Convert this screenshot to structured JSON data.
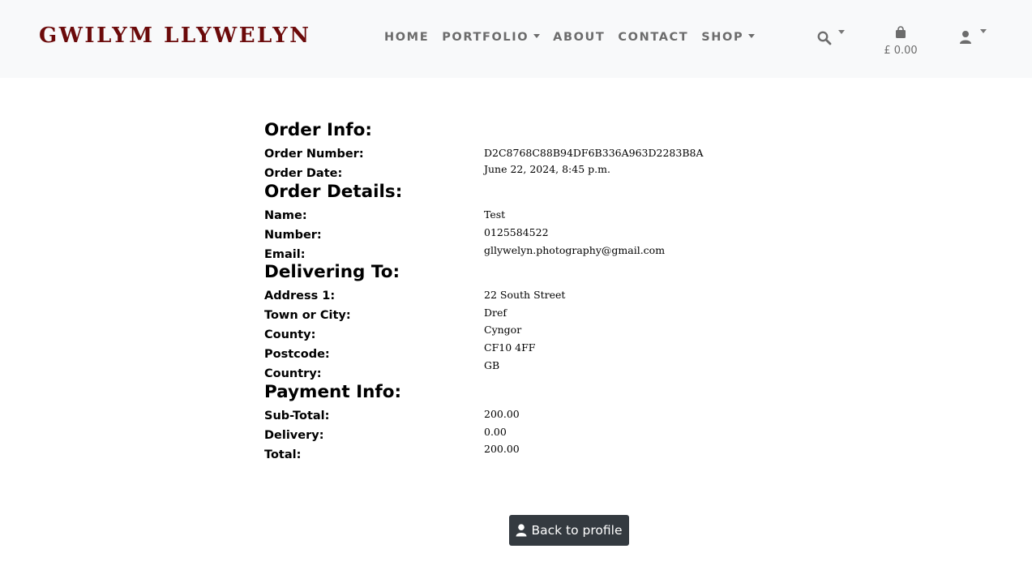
{
  "brand": {
    "name": "GWILYM LLYWELYN"
  },
  "nav": [
    {
      "label": "HOME",
      "dropdown": false
    },
    {
      "label": "PORTFOLIO",
      "dropdown": true
    },
    {
      "label": "ABOUT",
      "dropdown": false
    },
    {
      "label": "CONTACT",
      "dropdown": false
    },
    {
      "label": "SHOP",
      "dropdown": true
    }
  ],
  "cart": {
    "total": "£ 0.00"
  },
  "order_info": {
    "heading": "Order Info:",
    "number_label": "Order Number:",
    "number": "D2C8768C88B94DF6B336A963D2283B8A",
    "date_label": "Order Date:",
    "date": "June 22, 2024, 8:45 p.m."
  },
  "order_details": {
    "heading": "Order Details:",
    "name_label": "Name:",
    "name": "Test",
    "number_label": "Number:",
    "number": "0125584522",
    "email_label": "Email:",
    "email": "gllywelyn.photography@gmail.com"
  },
  "delivering": {
    "heading": "Delivering To:",
    "address1_label": "Address 1:",
    "address1": "22 South Street",
    "town_label": "Town or City:",
    "town": "Dref",
    "county_label": "County:",
    "county": "Cyngor",
    "postcode_label": "Postcode:",
    "postcode": "CF10 4FF",
    "country_label": "Country:",
    "country": "GB"
  },
  "payment": {
    "heading": "Payment Info:",
    "subtotal_label": "Sub-Total:",
    "subtotal": "200.00",
    "delivery_label": "Delivery:",
    "delivery": "0.00",
    "total_label": "Total:",
    "total": "200.00"
  },
  "back_button": {
    "label": "Back to profile"
  },
  "icons": {
    "search": "search-icon",
    "cart": "shopping-bag-icon",
    "user": "user-icon",
    "button": "user-icon"
  }
}
